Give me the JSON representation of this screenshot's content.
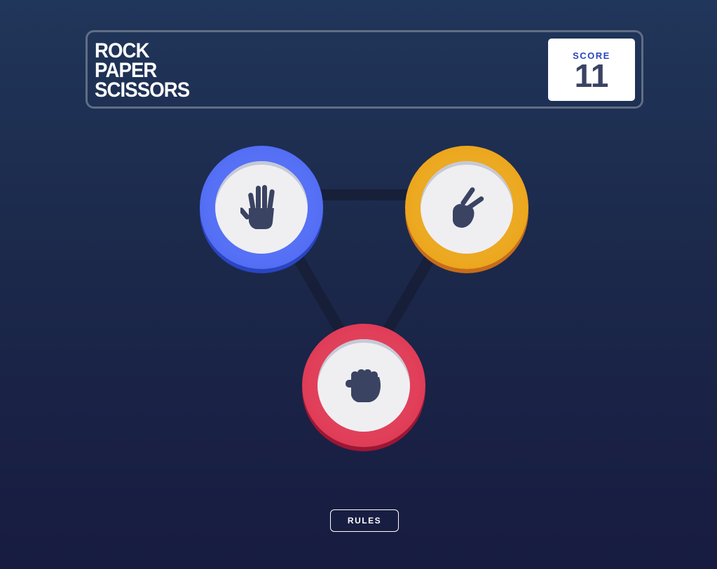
{
  "header": {
    "title_lines": [
      "ROCK",
      "PAPER",
      "SCISSORS"
    ],
    "score_label": "SCORE",
    "score_value": "11"
  },
  "choices": [
    {
      "name": "paper",
      "icon": "paper-hand-icon",
      "color": "#4865f4"
    },
    {
      "name": "scissors",
      "icon": "scissors-hand-icon",
      "color": "#ec9e0e"
    },
    {
      "name": "rock",
      "icon": "rock-fist-icon",
      "color": "#dc2e4e"
    }
  ],
  "rules_label": "RULES",
  "colors": {
    "icon": "#3b4363",
    "connector": "#161d35"
  }
}
